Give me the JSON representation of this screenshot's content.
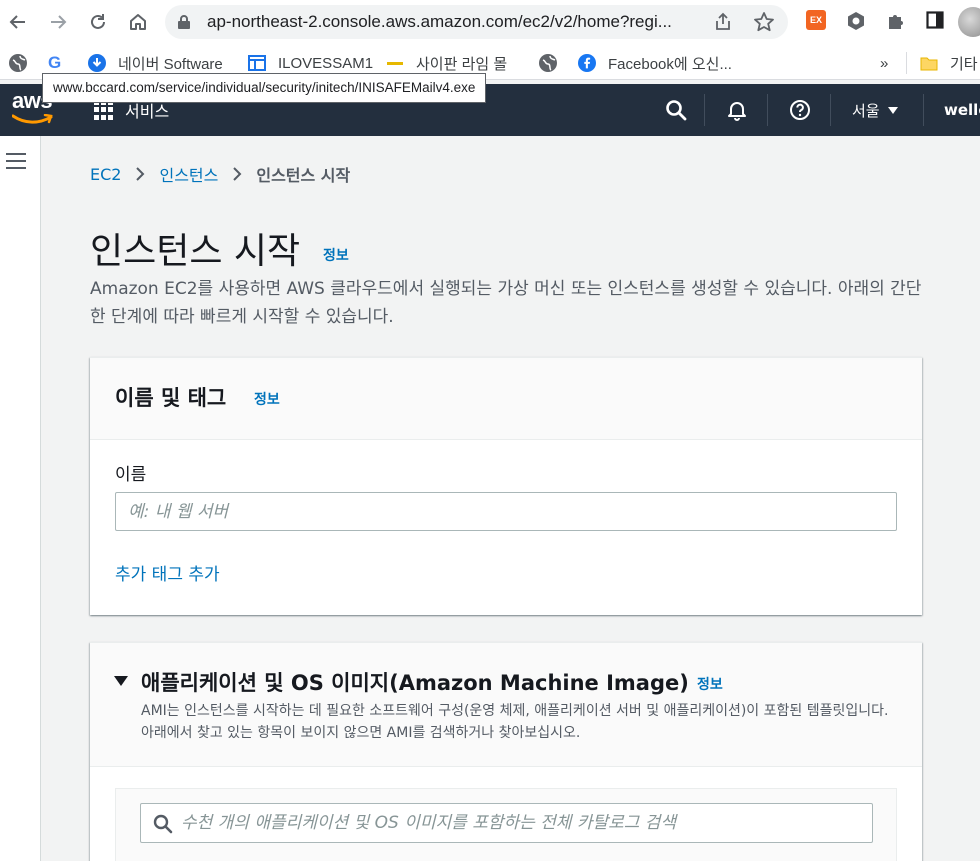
{
  "browser": {
    "url": "ap-northeast-2.console.aws.amazon.com/ec2/v2/home?regi...",
    "extension_badge": "EX",
    "bookmarks": [
      {
        "label": "네이버 Software"
      },
      {
        "label": "ILOVESSAM1"
      },
      {
        "label": "사이판 라임 몰"
      },
      {
        "label": "Facebook에 오신..."
      }
    ],
    "more_bookmarks": "»",
    "other_folder": "기타",
    "hover_link": "www.bccard.com/service/individual/security/initech/INISAFEMailv4.exe"
  },
  "aws_nav": {
    "logo": "aws",
    "services": "서비스",
    "region": "서울",
    "user": "wellc"
  },
  "breadcrumb": {
    "items": [
      "EC2",
      "인스턴스"
    ],
    "current": "인스턴스 시작"
  },
  "page": {
    "title": "인스턴스 시작",
    "info": "정보",
    "description": "Amazon EC2를 사용하면 AWS 클라우드에서 실행되는 가상 머신 또는 인스턴스를 생성할 수 있습니다. 아래의 간단한 단계에 따라 빠르게 시작할 수 있습니다."
  },
  "name_tags": {
    "heading": "이름 및 태그",
    "info": "정보",
    "name_label": "이름",
    "name_placeholder": "예: 내 웹 서버",
    "add_tags": "추가 태그 추가"
  },
  "ami": {
    "heading": "애플리케이션 및 OS 이미지(Amazon Machine Image)",
    "info": "정보",
    "description": "AMI는 인스턴스를 시작하는 데 필요한 소프트웨어 구성(운영 체제, 애플리케이션 서버 및 애플리케이션)이 포함된 템플릿입니다. 아래에서 찾고 있는 항목이 보이지 않으면 AMI를 검색하거나 찾아보십시오.",
    "search_placeholder": "수천 개의 애플리케이션 및 OS 이미지를 포함하는 전체 카탈로그 검색"
  },
  "colors": {
    "aws_nav_bg": "#232f3e",
    "link": "#0073bb",
    "page_bg": "#f2f3f3"
  }
}
